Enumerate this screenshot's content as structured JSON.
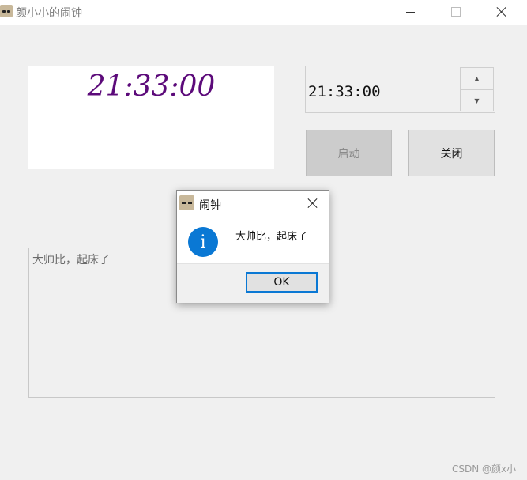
{
  "window": {
    "title": "颜小小的闹钟",
    "icon": "bear-avatar-icon"
  },
  "clock": {
    "display_time": "21:33:00",
    "color": "#5c0a7a"
  },
  "time_edit": {
    "value": "21:33:00",
    "spin_up": "▲",
    "spin_down": "▼"
  },
  "buttons": {
    "start_label": "启动",
    "close_label": "关闭"
  },
  "message_area": {
    "text": "大帅比，起床了"
  },
  "dialog": {
    "title": "闹钟",
    "icon": "bear-avatar-icon",
    "info_icon": "info-icon",
    "info_symbol": "i",
    "message": "大帅比，起床了",
    "ok_label": "OK",
    "accent": "#0a78d4"
  },
  "watermark": "CSDN @颜x小"
}
